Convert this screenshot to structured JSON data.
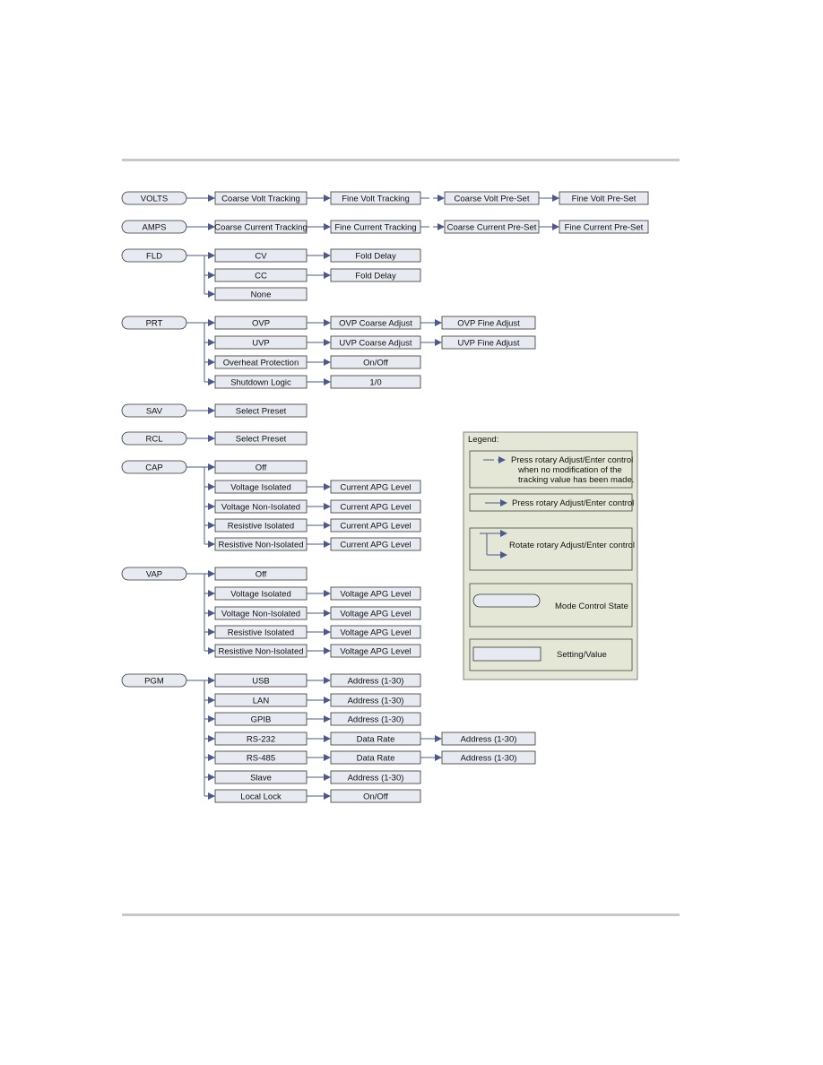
{
  "colors": {
    "box_fill": "#e8eaf2",
    "box_stroke": "#333333",
    "arrow": "#4a5a8c",
    "legend_bg": "#e4e7d6"
  },
  "groups": [
    {
      "mode": "VOLTS",
      "rows": [
        [
          "Coarse Volt Tracking",
          "Fine Volt Tracking",
          "Coarse Volt Pre-Set",
          "Fine Volt Pre-Set"
        ]
      ],
      "chain": true
    },
    {
      "mode": "AMPS",
      "rows": [
        [
          "Coarse Current Tracking",
          "Fine Current Tracking",
          "Coarse Current Pre-Set",
          "Fine Current Pre-Set"
        ]
      ],
      "chain": true
    },
    {
      "mode": "FLD",
      "rows": [
        [
          "CV",
          "Fold Delay"
        ],
        [
          "CC",
          "Fold Delay"
        ],
        [
          "None"
        ]
      ]
    },
    {
      "mode": "PRT",
      "rows": [
        [
          "OVP",
          "OVP Coarse Adjust",
          "OVP Fine Adjust"
        ],
        [
          "UVP",
          "UVP Coarse Adjust",
          "UVP Fine Adjust"
        ],
        [
          "Overheat Protection",
          "On/Off"
        ],
        [
          "Shutdown Logic",
          "1/0"
        ]
      ]
    },
    {
      "mode": "SAV",
      "rows": [
        [
          "Select Preset"
        ]
      ]
    },
    {
      "mode": "RCL",
      "rows": [
        [
          "Select Preset"
        ]
      ]
    },
    {
      "mode": "CAP",
      "rows": [
        [
          "Off"
        ],
        [
          "Voltage Isolated",
          "Current APG Level"
        ],
        [
          "Voltage Non-Isolated",
          "Current APG Level"
        ],
        [
          "Resistive Isolated",
          "Current APG Level"
        ],
        [
          "Resistive Non-Isolated",
          "Current APG Level"
        ]
      ]
    },
    {
      "mode": "VAP",
      "rows": [
        [
          "Off"
        ],
        [
          "Voltage Isolated",
          "Voltage APG Level"
        ],
        [
          "Voltage Non-Isolated",
          "Voltage APG Level"
        ],
        [
          "Resistive Isolated",
          "Voltage APG Level"
        ],
        [
          "Resistive Non-Isolated",
          "Voltage APG Level"
        ]
      ]
    },
    {
      "mode": "PGM",
      "rows": [
        [
          "USB",
          "Address (1-30)"
        ],
        [
          "LAN",
          "Address (1-30)"
        ],
        [
          "GPIB",
          "Address (1-30)"
        ],
        [
          "RS-232",
          "Data Rate",
          "Address (1-30)"
        ],
        [
          "RS-485",
          "Data Rate",
          "Address (1-30)"
        ],
        [
          "Slave",
          "Address (1-30)"
        ],
        [
          "Local Lock",
          "On/Off"
        ]
      ]
    }
  ],
  "legend": {
    "title": "Legend:",
    "items": [
      {
        "type": "gap-arrow",
        "lines": [
          "Press rotary Adjust/Enter control",
          "when no modification of the",
          "tracking value has been made."
        ]
      },
      {
        "type": "arrow",
        "lines": [
          "Press rotary Adjust/Enter control"
        ]
      },
      {
        "type": "branch",
        "lines": [
          "Rotate rotary Adjust/Enter control"
        ]
      },
      {
        "type": "pill",
        "lines": [
          "Mode Control State"
        ]
      },
      {
        "type": "box",
        "lines": [
          "Setting/Value"
        ]
      }
    ]
  }
}
